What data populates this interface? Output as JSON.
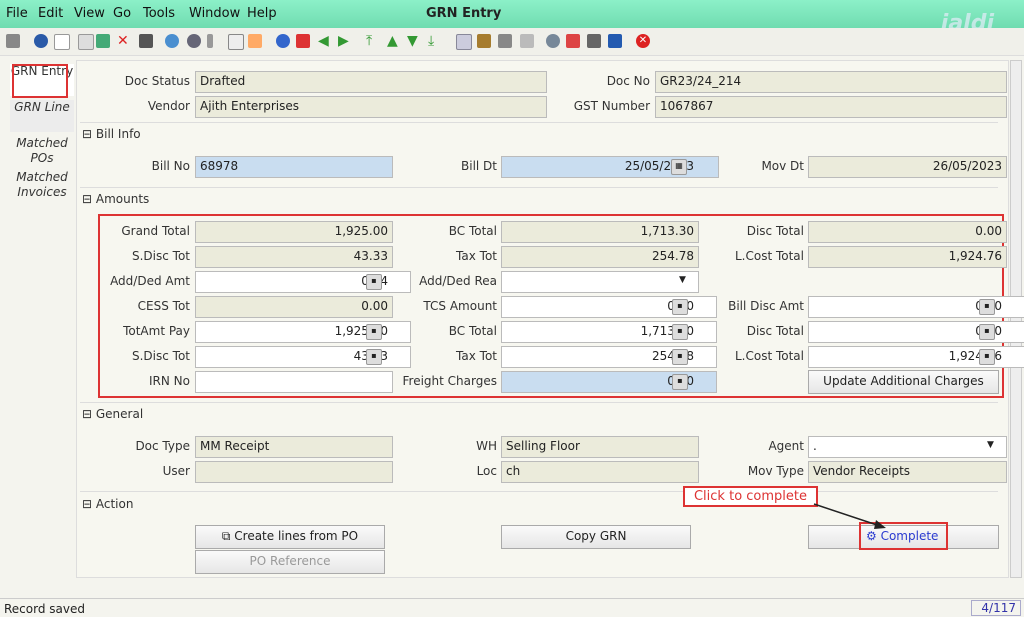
{
  "window_title": "GRN Entry",
  "logo": "jaldi",
  "menu": [
    "File",
    "Edit",
    "View",
    "Go",
    "Tools",
    "Window",
    "Help"
  ],
  "tabs": [
    "GRN Entry",
    "GRN Line",
    "Matched POs",
    "Matched Invoices"
  ],
  "header": {
    "doc_status_label": "Doc Status",
    "doc_status": "Drafted",
    "vendor_label": "Vendor",
    "vendor": "Ajith Enterprises",
    "doc_no_label": "Doc No",
    "doc_no": "GR23/24_214",
    "gst_label": "GST Number",
    "gst": "1067867"
  },
  "bill_info": {
    "section": "Bill Info",
    "bill_no_label": "Bill No",
    "bill_no": "68978",
    "bill_dt_label": "Bill Dt",
    "bill_dt": "25/05/2023",
    "mov_dt_label": "Mov Dt",
    "mov_dt": "26/05/2023"
  },
  "amounts": {
    "section": "Amounts",
    "grand_total_label": "Grand Total",
    "grand_total": "1,925.00",
    "bc_total_label": "BC Total",
    "bc_total": "1,713.30",
    "disc_total_label": "Disc Total",
    "disc_total": "0.00",
    "sdisc_tot_label": "S.Disc Tot",
    "sdisc_tot": "43.33",
    "tax_tot_label": "Tax Tot",
    "tax_tot": "254.78",
    "lcost_total_label": "L.Cost Total",
    "lcost_total": "1,924.76",
    "add_ded_amt_label": "Add/Ded Amt",
    "add_ded_amt": "0.24",
    "add_ded_rea_label": "Add/Ded Rea",
    "add_ded_rea": "",
    "cess_tot_label": "CESS Tot",
    "cess_tot": "0.00",
    "tcs_amount_label": "TCS Amount",
    "tcs_amount": "0.00",
    "bill_disc_amt_label": "Bill Disc Amt",
    "bill_disc_amt": "0.00",
    "totamt_pay_label": "TotAmt Pay",
    "totamt_pay": "1,925.00",
    "bc_total2_label": "BC Total",
    "bc_total2": "1,713.30",
    "disc_total2_label": "Disc Total",
    "disc_total2": "0.00",
    "sdisc_tot2_label": "S.Disc Tot",
    "sdisc_tot2": "43.33",
    "tax_tot2_label": "Tax Tot",
    "tax_tot2": "254.78",
    "lcost_total2_label": "L.Cost Total",
    "lcost_total2": "1,924.76",
    "irn_no_label": "IRN No",
    "irn_no": "",
    "freight_label": "Freight Charges",
    "freight": "0.00",
    "update_btn": "Update Additional Charges"
  },
  "general": {
    "section": "General",
    "doc_type_label": "Doc Type",
    "doc_type": "MM Receipt",
    "user_label": "User",
    "user": "",
    "wh_label": "WH",
    "wh": "Selling Floor",
    "loc_label": "Loc",
    "loc": "ch",
    "agent_label": "Agent",
    "agent": ".",
    "mov_type_label": "Mov Type",
    "mov_type": "Vendor Receipts"
  },
  "action": {
    "section": "Action",
    "create_lines": "Create lines from PO",
    "po_reference": "PO Reference",
    "copy_grn": "Copy GRN",
    "complete": "Complete",
    "callout": "Click to complete"
  },
  "status": {
    "message": "Record saved",
    "page": "4/117"
  }
}
